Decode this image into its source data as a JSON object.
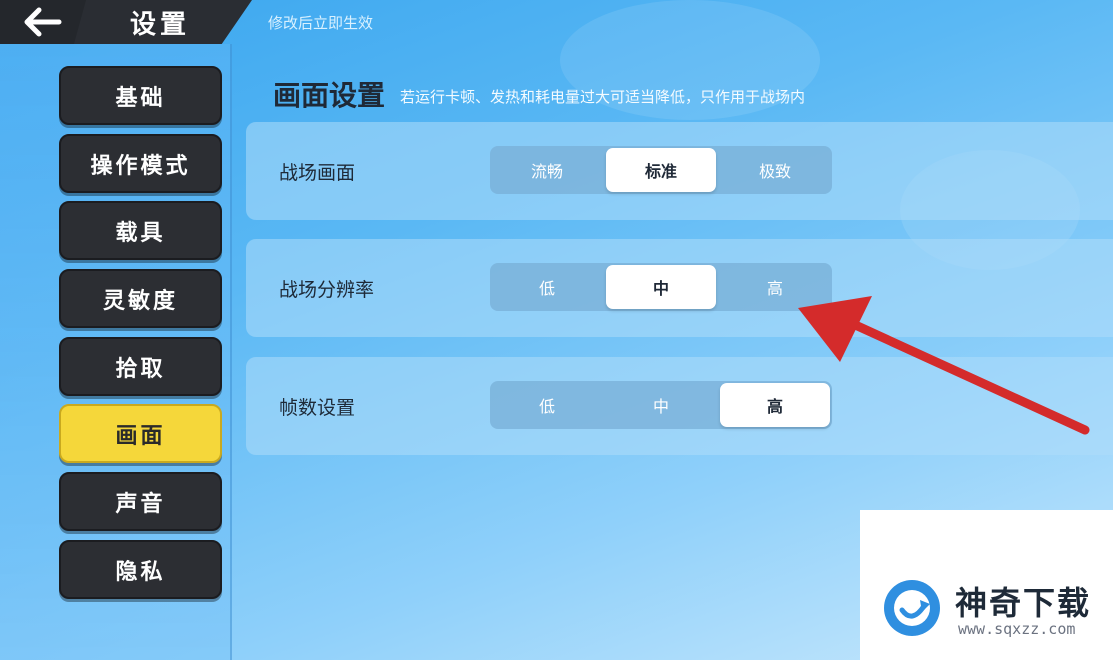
{
  "header": {
    "title": "设置",
    "hint": "修改后立即生效"
  },
  "sidebar": {
    "items": [
      {
        "label": "基础",
        "active": false
      },
      {
        "label": "操作模式",
        "active": false
      },
      {
        "label": "载具",
        "active": false
      },
      {
        "label": "灵敏度",
        "active": false
      },
      {
        "label": "拾取",
        "active": false
      },
      {
        "label": "画面",
        "active": true
      },
      {
        "label": "声音",
        "active": false
      },
      {
        "label": "隐私",
        "active": false
      }
    ]
  },
  "main": {
    "title": "画面设置",
    "description": "若运行卡顿、发热和耗电量过大可适当降低，只作用于战场内",
    "settings": [
      {
        "label": "战场画面",
        "options": [
          "流畅",
          "标准",
          "极致"
        ],
        "selected": "标准"
      },
      {
        "label": "战场分辨率",
        "options": [
          "低",
          "中",
          "高"
        ],
        "selected": "中"
      },
      {
        "label": "帧数设置",
        "options": [
          "低",
          "中",
          "高"
        ],
        "selected": "高"
      }
    ]
  },
  "watermark": {
    "name": "神奇下载",
    "url": "www.sqxzz.com"
  },
  "colors": {
    "accent_active": "#f5d73a",
    "sidebar_button": "#2c2e33",
    "annotation_arrow": "#d42b2b"
  },
  "icons": [
    "back-arrow-icon",
    "red-annotation-arrow",
    "watermark-logo-icon"
  ]
}
